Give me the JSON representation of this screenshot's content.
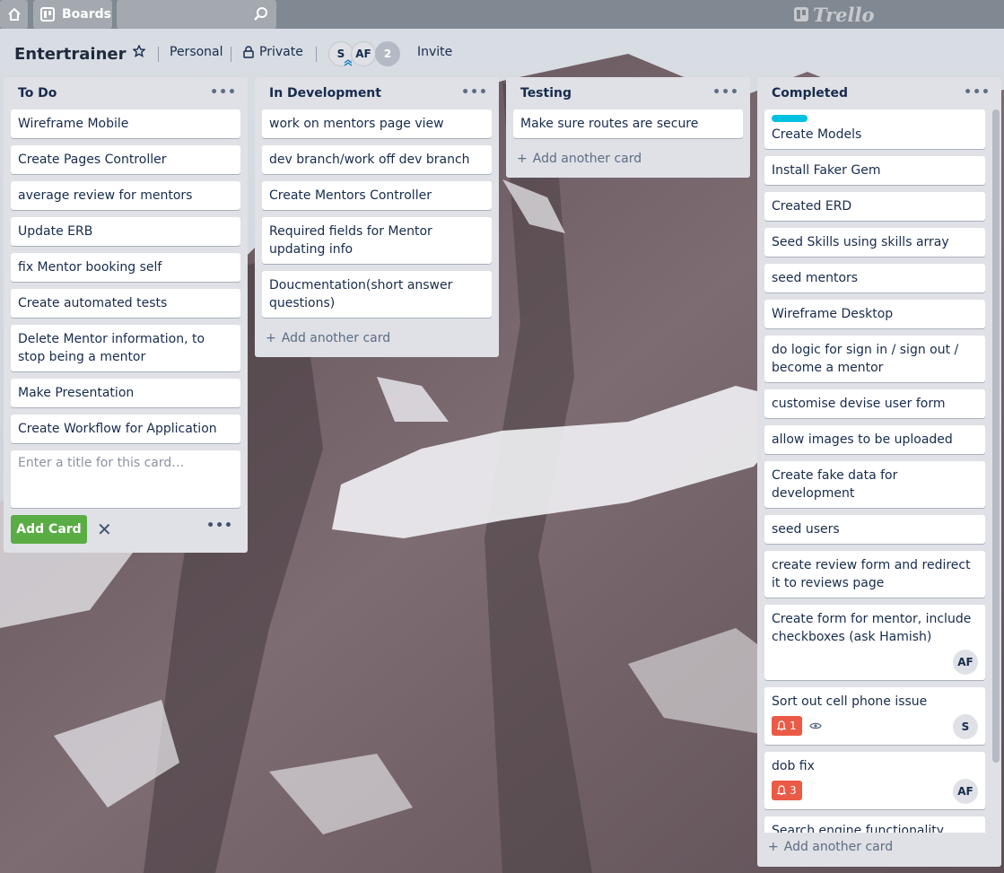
{
  "topbar": {
    "boards_label": "Boards",
    "logo_text": "Trello",
    "search_value": ""
  },
  "board": {
    "title": "Entertrainer",
    "team": "Personal",
    "visibility": "Private",
    "members": [
      "S",
      "AF"
    ],
    "member_count": "2",
    "invite_label": "Invite"
  },
  "lists": {
    "todo": {
      "title": "To Do",
      "cards": [
        "Wireframe Mobile",
        "Create Pages Controller",
        "average review for mentors",
        "Update ERB",
        "fix Mentor booking self",
        "Create automated tests",
        "Delete Mentor information, to stop being a mentor",
        "Make Presentation",
        "Create Workflow for Application"
      ],
      "composer_placeholder": "Enter a title for this card…",
      "add_card_button": "Add Card"
    },
    "dev": {
      "title": "In Development",
      "cards": [
        "work on mentors page view",
        "dev branch/work off dev branch",
        "Create Mentors Controller",
        "Required fields for Mentor updating info",
        "Doucmentation(short answer questions)"
      ],
      "add_another": "Add another card"
    },
    "testing": {
      "title": "Testing",
      "cards": [
        "Make sure routes are secure"
      ],
      "add_another": "Add another card"
    },
    "completed": {
      "title": "Completed",
      "cards": [
        "Create Models",
        "Install Faker Gem",
        "Created ERD",
        "Seed Skills using skills array",
        "seed mentors",
        "Wireframe Desktop",
        "do logic for sign in / sign out / become a mentor",
        "customise devise user form",
        "allow images to be uploaded",
        "Create fake data for development",
        "seed users",
        "create review form and redirect it to reviews page",
        "Create form for mentor, include checkboxes (ask Hamish)",
        "Sort out cell phone issue",
        "dob fix",
        "Search engine functionality"
      ],
      "card_avatar_af": "AF",
      "card_avatar_s": "S",
      "badge_phone": "1",
      "badge_dob": "3",
      "add_another": "Add another card"
    }
  },
  "colors": {
    "label_cyan": "#00c2e0",
    "label_green": "#61bd4f",
    "badge_red": "#eb5a46",
    "add_button_green": "#5aac44"
  }
}
